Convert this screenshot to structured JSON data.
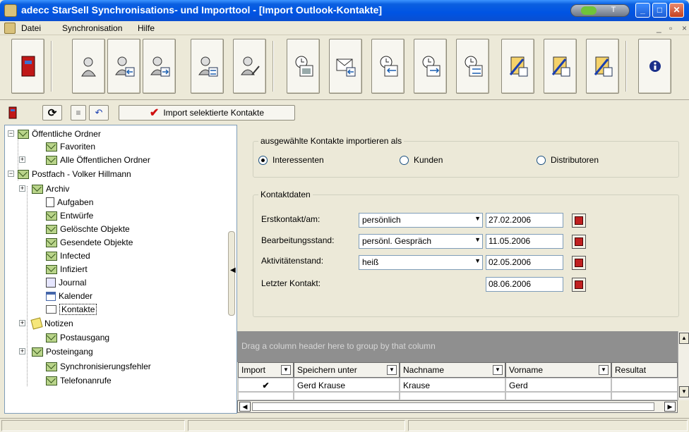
{
  "window": {
    "title": "adecc StarSell Synchronisations- und Importtool - [Import Outlook-Kontakte]",
    "tray_text": "T"
  },
  "menu": {
    "items": [
      "Datei",
      "Synchronisation",
      "Hilfe"
    ],
    "mdi_controls": [
      "_",
      "▫",
      "×"
    ]
  },
  "toolbar2": {
    "import_label": "Import selektierte Kontakte",
    "check_glyph": "✔"
  },
  "tree": {
    "items": [
      {
        "label": "Öffentliche Ordner",
        "expander": "−"
      },
      {
        "label": "Favoriten"
      },
      {
        "label": "Alle Öffentlichen Ordner",
        "expander": "+"
      },
      {
        "label": "Postfach - Volker Hillmann",
        "expander": "−"
      },
      {
        "label": "Archiv",
        "expander": "+"
      },
      {
        "label": "Aufgaben"
      },
      {
        "label": "Entwürfe"
      },
      {
        "label": "Gelöschte Objekte"
      },
      {
        "label": "Gesendete Objekte"
      },
      {
        "label": "Infected"
      },
      {
        "label": "Infiziert"
      },
      {
        "label": "Journal"
      },
      {
        "label": "Kalender"
      },
      {
        "label": "Kontakte",
        "selected": true
      },
      {
        "label": "Notizen",
        "expander": "+"
      },
      {
        "label": "Postausgang"
      },
      {
        "label": "Posteingang",
        "expander": "+"
      },
      {
        "label": "Synchronisierungsfehler"
      },
      {
        "label": "Telefonanrufe"
      }
    ]
  },
  "import_as": {
    "title": "ausgewählte Kontakte importieren als",
    "options": [
      {
        "label": "Interessenten",
        "selected": true
      },
      {
        "label": "Kunden",
        "selected": false
      },
      {
        "label": "Distributoren",
        "selected": false
      }
    ]
  },
  "kontaktdaten": {
    "title": "Kontaktdaten",
    "rows": [
      {
        "label": "Erstkontakt/am:",
        "combo": "persönlich",
        "date": "27.02.2006"
      },
      {
        "label": "Bearbeitungsstand:",
        "combo": "persönl. Gespräch",
        "date": "11.05.2006"
      },
      {
        "label": "Aktivitätenstand:",
        "combo": "heiß",
        "date": "02.05.2006"
      },
      {
        "label": "Letzter Kontakt:",
        "combo": null,
        "date": "08.06.2006"
      }
    ]
  },
  "grid": {
    "group_hint": "Drag a column header here to group by that column",
    "columns": [
      "Import",
      "Speichern unter",
      "Nachname",
      "Vorname",
      "Resultat"
    ],
    "rows": [
      {
        "import": "✔",
        "speichern_unter": "Gerd Krause",
        "nachname": "Krause",
        "vorname": "Gerd",
        "resultat": ""
      }
    ]
  },
  "colors": {
    "titlebar": "#0054e3",
    "window_bg": "#ece9d8",
    "group_header_bg": "#8f8f8f",
    "check_red": "#d01010"
  }
}
